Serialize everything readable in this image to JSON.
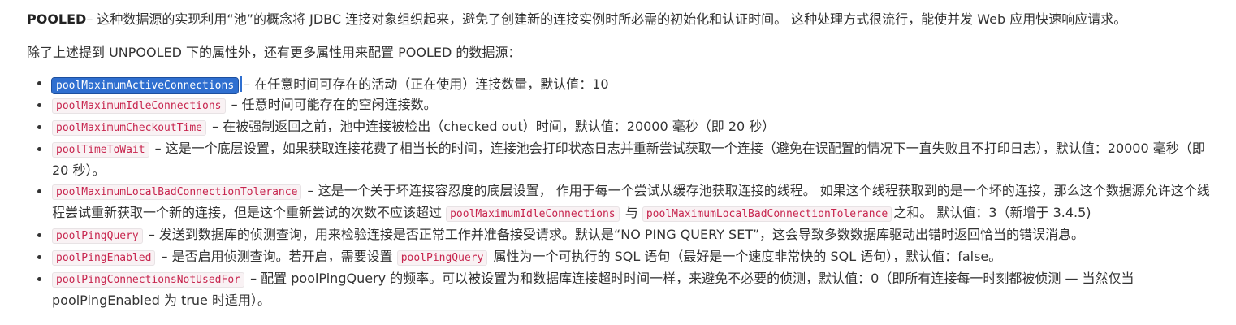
{
  "intro": {
    "term": "POOLED",
    "text": "– 这种数据源的实现利用“池”的概念将 JDBC 连接对象组织起来，避免了创建新的连接实例时所必需的初始化和认证时间。 这种处理方式很流行，能使并发 Web 应用快速响应请求。"
  },
  "subtitle": "除了上述提到 UNPOOLED 下的属性外，还有更多属性用来配置 POOLED 的数据源：",
  "properties": [
    {
      "code": "poolMaximumActiveConnections",
      "desc": "– 在任意时间可存在的活动（正在使用）连接数量，默认值：10"
    },
    {
      "code": "poolMaximumIdleConnections",
      "desc": "– 任意时间可能存在的空闲连接数。"
    },
    {
      "code": "poolMaximumCheckoutTime",
      "desc": "– 在被强制返回之前，池中连接被检出（checked out）时间，默认值：20000 毫秒（即 20 秒）"
    },
    {
      "code": "poolTimeToWait",
      "desc": "– 这是一个底层设置，如果获取连接花费了相当长的时间，连接池会打印状态日志并重新尝试获取一个连接（避免在误配置的情况下一直失败且不打印日志），默认值：20000 毫秒（即 20 秒）。"
    },
    {
      "code": "poolMaximumLocalBadConnectionTolerance",
      "desc_a": "– 这是一个关于坏连接容忍度的底层设置， 作用于每一个尝试从缓存池获取连接的线程。 如果这个线程获取到的是一个坏的连接，那么这个数据源允许这个线程尝试重新获取一个新的连接，但是这个重新尝试的次数不应该超过",
      "code_b": "poolMaximumIdleConnections",
      "desc_b": "与",
      "code_c": "poolMaximumLocalBadConnectionTolerance",
      "desc_c": "之和。 默认值：3（新增于 3.4.5)"
    },
    {
      "code": "poolPingQuery",
      "desc": "– 发送到数据库的侦测查询，用来检验连接是否正常工作并准备接受请求。默认是“NO PING QUERY SET”，这会导致多数数据库驱动出错时返回恰当的错误消息。"
    },
    {
      "code": "poolPingEnabled",
      "desc_a": "– 是否启用侦测查询。若开启，需要设置",
      "code_b": "poolPingQuery",
      "desc_b": "属性为一个可执行的 SQL 语句（最好是一个速度非常快的 SQL 语句），默认值：false。"
    },
    {
      "code": "poolPingConnectionsNotUsedFor",
      "desc": "– 配置 poolPingQuery 的频率。可以被设置为和数据库连接超时时间一样，来避免不必要的侦测，默认值：0（即所有连接每一时刻都被侦测 — 当然仅当 poolPingEnabled 为 true 时适用）。"
    }
  ]
}
